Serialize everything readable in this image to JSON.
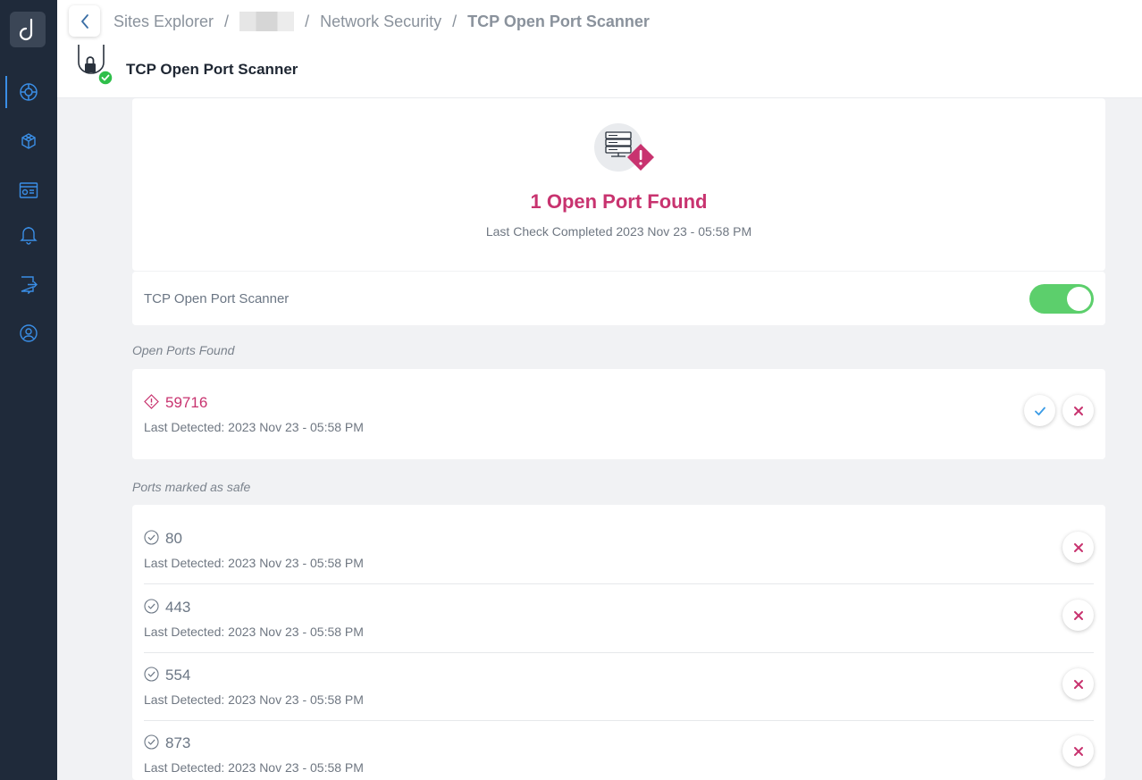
{
  "sidebar": {
    "logo_icon": "d-logo-icon",
    "items": [
      {
        "icon": "globe-icon",
        "active": true
      },
      {
        "icon": "cubes-icon",
        "active": false
      },
      {
        "icon": "browser-window-icon",
        "active": false
      },
      {
        "icon": "bell-icon",
        "active": false
      },
      {
        "icon": "note-arrow-icon",
        "active": false
      },
      {
        "icon": "support-icon",
        "active": false
      }
    ]
  },
  "header": {
    "breadcrumb": {
      "item1": "Sites Explorer",
      "item3": "Network Security",
      "item4": "TCP Open Port Scanner",
      "separator": "/"
    },
    "title": "TCP Open Port Scanner"
  },
  "summary": {
    "title": "1 Open Port Found",
    "subtitle": "Last Check Completed 2023 Nov 23 - 05:58 PM"
  },
  "scanner_toggle": {
    "label": "TCP Open Port Scanner",
    "enabled": true
  },
  "open_ports": {
    "section_label": "Open Ports Found",
    "items": [
      {
        "port": "59716",
        "detected": "Last Detected: 2023 Nov 23 - 05:58 PM"
      }
    ]
  },
  "safe_ports": {
    "section_label": "Ports marked as safe",
    "items": [
      {
        "port": "80",
        "detected": "Last Detected: 2023 Nov 23 - 05:58 PM"
      },
      {
        "port": "443",
        "detected": "Last Detected: 2023 Nov 23 - 05:58 PM"
      },
      {
        "port": "554",
        "detected": "Last Detected: 2023 Nov 23 - 05:58 PM"
      },
      {
        "port": "873",
        "detected": "Last Detected: 2023 Nov 23 - 05:58 PM"
      }
    ]
  },
  "colors": {
    "sidebar_bg": "#1f2a3a",
    "accent_pink": "#c8336f",
    "toggle_green": "#5ccf6c",
    "safe_gray": "#6b7684",
    "check_blue": "#3a9be6",
    "status_green": "#2fbf4a"
  }
}
